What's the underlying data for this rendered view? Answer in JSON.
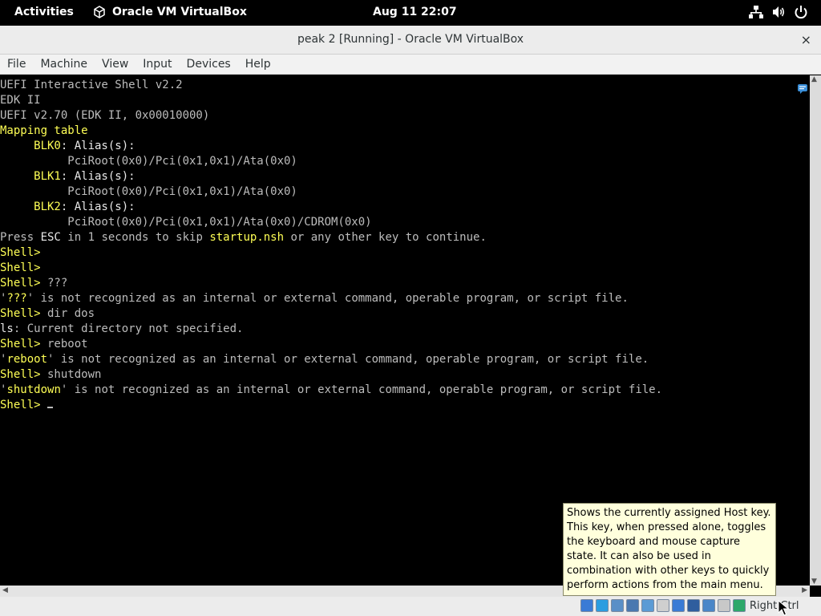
{
  "topbar": {
    "activities": "Activities",
    "app_name": "Oracle VM VirtualBox",
    "clock": "Aug 11  22:07"
  },
  "window": {
    "title": "peak 2 [Running] - Oracle VM VirtualBox",
    "close": "×"
  },
  "menu": {
    "items": [
      "File",
      "Machine",
      "View",
      "Input",
      "Devices",
      "Help"
    ]
  },
  "terminal": {
    "lines": [
      {
        "segments": [
          {
            "t": "UEFI Interactive Shell v2.2",
            "c": "g"
          }
        ]
      },
      {
        "segments": [
          {
            "t": "EDK II",
            "c": "g"
          }
        ]
      },
      {
        "segments": [
          {
            "t": "UEFI v2.70 (EDK II, 0x00010000)",
            "c": "g"
          }
        ]
      },
      {
        "segments": [
          {
            "t": "Mapping table",
            "c": "y"
          }
        ]
      },
      {
        "segments": [
          {
            "t": "     BLK0",
            "c": "y"
          },
          {
            "t": ": Alias(s):",
            "c": "w"
          }
        ]
      },
      {
        "segments": [
          {
            "t": "          PciRoot(0x0)/Pci(0x1,0x1)/Ata(0x0)",
            "c": "g"
          }
        ]
      },
      {
        "segments": [
          {
            "t": "     BLK1",
            "c": "y"
          },
          {
            "t": ": Alias(s):",
            "c": "w"
          }
        ]
      },
      {
        "segments": [
          {
            "t": "          PciRoot(0x0)/Pci(0x1,0x1)/Ata(0x0)",
            "c": "g"
          }
        ]
      },
      {
        "segments": [
          {
            "t": "     BLK2",
            "c": "y"
          },
          {
            "t": ": Alias(s):",
            "c": "w"
          }
        ]
      },
      {
        "segments": [
          {
            "t": "          PciRoot(0x0)/Pci(0x1,0x1)/Ata(0x0)/CDROM(0x0)",
            "c": "g"
          }
        ]
      },
      {
        "segments": [
          {
            "t": "Press ",
            "c": "g"
          },
          {
            "t": "ESC",
            "c": "w"
          },
          {
            "t": " in 1 seconds to skip ",
            "c": "g"
          },
          {
            "t": "startup.nsh",
            "c": "y"
          },
          {
            "t": " or any other key to continue.",
            "c": "g"
          }
        ]
      },
      {
        "segments": [
          {
            "t": "Shell>",
            "c": "y"
          }
        ]
      },
      {
        "segments": [
          {
            "t": "Shell>",
            "c": "y"
          }
        ]
      },
      {
        "segments": [
          {
            "t": "Shell>",
            "c": "y"
          },
          {
            "t": " ???",
            "c": "g"
          }
        ]
      },
      {
        "segments": [
          {
            "t": "'",
            "c": "g"
          },
          {
            "t": "???",
            "c": "y"
          },
          {
            "t": "' is not recognized as an internal or external command, operable program, or script file.",
            "c": "g"
          }
        ]
      },
      {
        "segments": [
          {
            "t": "Shell>",
            "c": "y"
          },
          {
            "t": " dir dos",
            "c": "g"
          }
        ]
      },
      {
        "segments": [
          {
            "t": "ls",
            "c": "w"
          },
          {
            "t": ": Current directory not specified.",
            "c": "g"
          }
        ]
      },
      {
        "segments": [
          {
            "t": "Shell>",
            "c": "y"
          },
          {
            "t": " reboot",
            "c": "g"
          }
        ]
      },
      {
        "segments": [
          {
            "t": "'",
            "c": "g"
          },
          {
            "t": "reboot",
            "c": "y"
          },
          {
            "t": "' is not recognized as an internal or external command, operable program, or script file.",
            "c": "g"
          }
        ]
      },
      {
        "segments": [
          {
            "t": "Shell>",
            "c": "y"
          },
          {
            "t": " shutdown",
            "c": "g"
          }
        ]
      },
      {
        "segments": [
          {
            "t": "'",
            "c": "g"
          },
          {
            "t": "shutdown",
            "c": "y"
          },
          {
            "t": "' is not recognized as an internal or external command, operable program, or script file.",
            "c": "g"
          }
        ]
      },
      {
        "segments": [
          {
            "t": "Shell>",
            "c": "y"
          },
          {
            "t": " ",
            "c": "g"
          }
        ],
        "cursor": true
      }
    ]
  },
  "tooltip": {
    "text": "Shows the currently assigned Host key. This key, when pressed alone, toggles the keyboard and mouse capture state. It can also be used in combination with other keys to quickly perform actions from the main menu."
  },
  "statusbar": {
    "host_key": "Right Ctrl",
    "icons": [
      {
        "name": "hard-disk-icon",
        "color": "#3a7bd5"
      },
      {
        "name": "optical-drive-icon",
        "color": "#2b9de0"
      },
      {
        "name": "audio-icon",
        "color": "#5a8fc7"
      },
      {
        "name": "network-icon",
        "color": "#4a78b0"
      },
      {
        "name": "usb-icon",
        "color": "#5b9bd5"
      },
      {
        "name": "shared-folders-icon",
        "color": "#cfcfcf"
      },
      {
        "name": "display-icon",
        "color": "#3a7bd5"
      },
      {
        "name": "recording-icon",
        "color": "#2f5e9e"
      },
      {
        "name": "cpu-icon",
        "color": "#4a86c8"
      },
      {
        "name": "mouse-integration-icon",
        "color": "#c8c8c8"
      },
      {
        "name": "keyboard-capture-icon",
        "color": "#2ea86a"
      }
    ]
  },
  "colors": {
    "shell_yellow": "#ffff55",
    "shell_gray": "#bcbcbc",
    "tooltip_bg": "#ffffdc"
  }
}
